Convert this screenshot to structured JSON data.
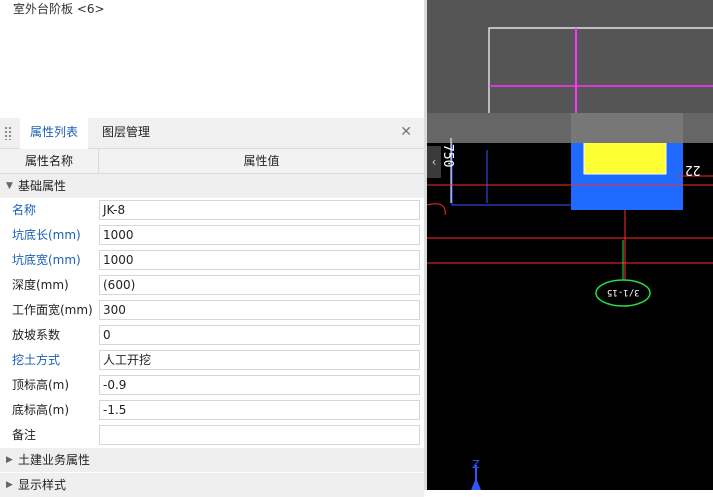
{
  "top_list": {
    "item": "室外台阶板 <6>"
  },
  "panel": {
    "tabs": [
      "属性列表",
      "图层管理"
    ],
    "close_symbol": "✕"
  },
  "table": {
    "header_name": "属性名称",
    "header_value": "属性值",
    "groups": {
      "basic": "基础属性",
      "civil": "土建业务属性",
      "display": "显示样式"
    },
    "rows": [
      {
        "name": "名称",
        "value": "JK-8",
        "link": true
      },
      {
        "name": "坑底长(mm)",
        "value": "1000",
        "link": true
      },
      {
        "name": "坑底宽(mm)",
        "value": "1000",
        "link": true
      },
      {
        "name": "深度(mm)",
        "value": "(600)",
        "link": false
      },
      {
        "name": "工作面宽(mm)",
        "value": "300",
        "link": false
      },
      {
        "name": "放坡系数",
        "value": "0",
        "link": false
      },
      {
        "name": "挖土方式",
        "value": "人工开挖",
        "link": true
      },
      {
        "name": "顶标高(m)",
        "value": "-0.9",
        "link": false
      },
      {
        "name": "底标高(m)",
        "value": "-1.5",
        "link": false
      },
      {
        "name": "备注",
        "value": "",
        "link": false
      }
    ]
  },
  "canvas": {
    "dim_left": "750",
    "dim_right": "22",
    "axis_label": "3/1-15",
    "axis_z": "Z",
    "colors": {
      "magenta": "#ff33ff",
      "yellow": "#ffff33",
      "blue": "#1f6bff",
      "red": "#ff2a2a",
      "green": "#22dd44"
    }
  }
}
